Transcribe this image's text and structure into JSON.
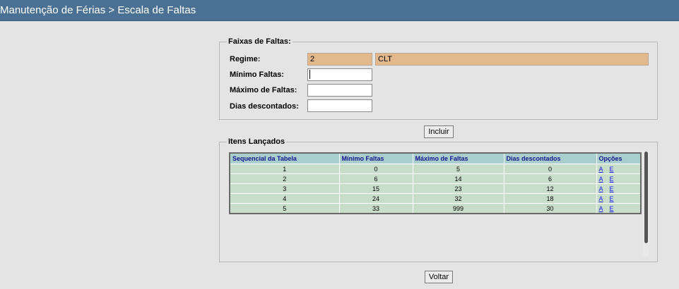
{
  "header": {
    "title": "Manutenção de Férias > Escala de Faltas"
  },
  "faixas": {
    "legend": "Faixas de Faltas:",
    "regime_label": "Regime:",
    "regime_code": "2",
    "regime_name": "CLT",
    "minimo_label": "Mínimo Faltas:",
    "minimo_value": "",
    "maximo_label": "Máximo de Faltas:",
    "maximo_value": "",
    "dias_label": "Dias descontados:",
    "dias_value": ""
  },
  "buttons": {
    "incluir": "Incluir",
    "voltar": "Voltar"
  },
  "itens": {
    "legend": "Itens Lançados",
    "columns": [
      "Sequencial da Tabela",
      "Mínimo Faltas",
      "Máximo de Faltas",
      "Dias descontados",
      "Opções"
    ],
    "rows": [
      {
        "seq": "1",
        "min": "0",
        "max": "5",
        "dias": "0",
        "a": "A",
        "e": "E"
      },
      {
        "seq": "2",
        "min": "6",
        "max": "14",
        "dias": "6",
        "a": "A",
        "e": "E"
      },
      {
        "seq": "3",
        "min": "15",
        "max": "23",
        "dias": "12",
        "a": "A",
        "e": "E"
      },
      {
        "seq": "4",
        "min": "24",
        "max": "32",
        "dias": "18",
        "a": "A",
        "e": "E"
      },
      {
        "seq": "5",
        "min": "33",
        "max": "999",
        "dias": "30",
        "a": "A",
        "e": "E"
      }
    ]
  },
  "colors": {
    "header_bg": "#4a7194",
    "readonly_bg": "#e3b88c",
    "table_header_bg": "#a9cece",
    "table_row_bg": "#c9ddcb",
    "link": "#1a1aee"
  }
}
